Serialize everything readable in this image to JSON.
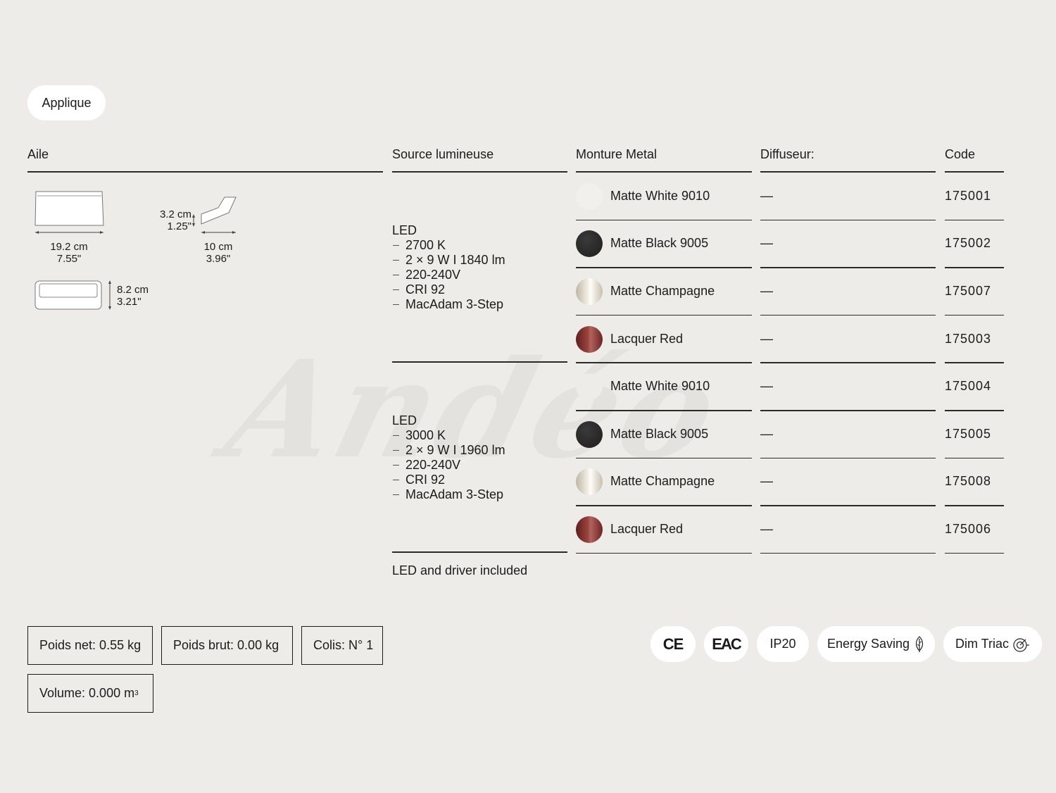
{
  "category_tag": "Applique",
  "headers": {
    "product": "Aile",
    "source": "Source lumineuse",
    "mount": "Monture Metal",
    "diffuser": "Diffuseur:",
    "code": "Code"
  },
  "dimensions": {
    "width_cm": "19.2 cm",
    "width_in": "7.55\"",
    "height_cm": "3.2 cm",
    "height_in": "1.25\"",
    "depth_cm": "10 cm",
    "depth_in": "3.96\"",
    "side_cm": "8.2 cm",
    "side_in": "3.21\""
  },
  "watermark": "Andéo",
  "led_groups": [
    {
      "title": "LED",
      "items": [
        "2700 K",
        "2 × 9 W I 1840 lm",
        "220-240V",
        "CRI 92",
        "MacAdam 3-Step"
      ]
    },
    {
      "title": "LED",
      "items": [
        "3000 K",
        "2 × 9 W I 1960 lm",
        "220-240V",
        "CRI 92",
        "MacAdam 3-Step"
      ]
    }
  ],
  "rows": [
    {
      "finish": "Matte White 9010",
      "diffuser": "—",
      "code": "175001",
      "swatch": "#f1f0ed"
    },
    {
      "finish": "Matte Black 9005",
      "diffuser": "—",
      "code": "175002",
      "swatch": "#2b2b2b"
    },
    {
      "finish": "Matte Champagne",
      "diffuser": "—",
      "code": "175007",
      "swatch": "#d8cfbf"
    },
    {
      "finish": "Lacquer Red",
      "diffuser": "—",
      "code": "175003",
      "swatch": "#7e2e2b"
    },
    {
      "finish": "Matte White 9010",
      "diffuser": "—",
      "code": "175004",
      "swatch": "#edece9"
    },
    {
      "finish": "Matte Black 9005",
      "diffuser": "—",
      "code": "175005",
      "swatch": "#2b2b2b"
    },
    {
      "finish": "Matte Champagne",
      "diffuser": "—",
      "code": "175008",
      "swatch": "#d8cfbf"
    },
    {
      "finish": "Lacquer Red",
      "diffuser": "—",
      "code": "175006",
      "swatch": "#7e2e2b"
    }
  ],
  "note": "LED and driver included",
  "specs": {
    "net_weight": "Poids net: 0.55 kg",
    "gross_weight": "Poids brut: 0.00 kg",
    "parcels": "Colis: N° 1",
    "volume": "Volume: 0.000 m",
    "volume_sup": "3"
  },
  "badges": {
    "ce": "CE",
    "eac": "EAC",
    "ip": "IP20",
    "energy": "Energy Saving",
    "dim": "Dim Triac"
  }
}
